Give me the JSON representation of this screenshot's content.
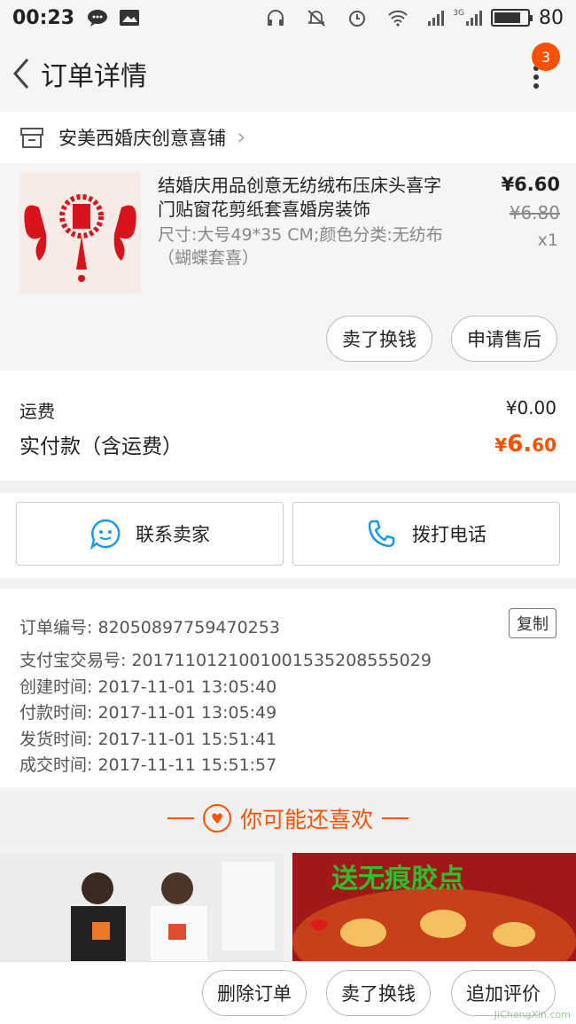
{
  "status_bar": {
    "time": "00:23",
    "battery": "80",
    "network": "3G",
    "battery_level": 0.8
  },
  "header": {
    "title": "订单详情",
    "badge_count": "3"
  },
  "shop": {
    "name": "安美西婚庆创意喜铺"
  },
  "item": {
    "name": "结婚庆用品创意无纺绒布压床头喜字门贴窗花剪纸套喜婚房装饰",
    "spec": "尺寸:大号49*35 CM;颜色分类:无纺布（蝴蝶套喜）",
    "price": "¥6.60",
    "original_price": "¥6.80",
    "quantity": "x1",
    "actions": [
      "卖了换钱",
      "申请售后"
    ]
  },
  "fees": {
    "shipping_label": "运费",
    "shipping_value": "¥0.00",
    "paid_label": "实付款（含运费）",
    "paid_currency": "¥",
    "paid_int": "6.",
    "paid_dec": "60"
  },
  "contact": {
    "seller_label": "联系卖家",
    "phone_label": "拨打电话"
  },
  "order_info": {
    "copy_label": "复制",
    "lines": [
      "订单编号: 82050897759470253",
      "支付宝交易号: 2017110121001001535208555029",
      "创建时间: 2017-11-01 13:05:40",
      "付款时间: 2017-11-01 13:05:49",
      "发货时间: 2017-11-01 15:51:41",
      "成交时间: 2017-11-11 15:51:57"
    ]
  },
  "recommend": {
    "title": "你可能还喜欢",
    "promo_text": "送无痕胶点"
  },
  "bottom_actions": [
    "删除订单",
    "卖了换钱",
    "追加评价"
  ],
  "watermark": "JiChengXin.com",
  "colors": {
    "accent": "#ff5000",
    "link_blue": "#1a9be6"
  }
}
